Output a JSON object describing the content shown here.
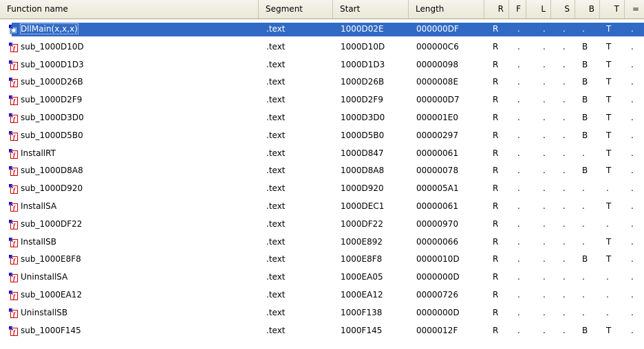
{
  "columns": [
    "Function name",
    "Segment",
    "Start",
    "Length",
    "R",
    "F",
    "L",
    "S",
    "B",
    "T",
    "="
  ],
  "rows": [
    {
      "name": "DllMain(x,x,x)",
      "segment": ".text",
      "start": "1000D02E",
      "length": "000000DF",
      "R": "R",
      "F": ".",
      "L": ".",
      "S": ".",
      "B": ".",
      "T": "T",
      "E": ".",
      "icon": "library-function-icon",
      "selected": true
    },
    {
      "name": "sub_1000D10D",
      "segment": ".text",
      "start": "1000D10D",
      "length": "000000C6",
      "R": "R",
      "F": ".",
      "L": ".",
      "S": ".",
      "B": "B",
      "T": "T",
      "E": ".",
      "icon": "function-icon"
    },
    {
      "name": "sub_1000D1D3",
      "segment": ".text",
      "start": "1000D1D3",
      "length": "00000098",
      "R": "R",
      "F": ".",
      "L": ".",
      "S": ".",
      "B": "B",
      "T": "T",
      "E": ".",
      "icon": "function-icon"
    },
    {
      "name": "sub_1000D26B",
      "segment": ".text",
      "start": "1000D26B",
      "length": "0000008E",
      "R": "R",
      "F": ".",
      "L": ".",
      "S": ".",
      "B": "B",
      "T": "T",
      "E": ".",
      "icon": "function-icon"
    },
    {
      "name": "sub_1000D2F9",
      "segment": ".text",
      "start": "1000D2F9",
      "length": "000000D7",
      "R": "R",
      "F": ".",
      "L": ".",
      "S": ".",
      "B": "B",
      "T": "T",
      "E": ".",
      "icon": "function-icon"
    },
    {
      "name": "sub_1000D3D0",
      "segment": ".text",
      "start": "1000D3D0",
      "length": "000001E0",
      "R": "R",
      "F": ".",
      "L": ".",
      "S": ".",
      "B": "B",
      "T": "T",
      "E": ".",
      "icon": "function-icon"
    },
    {
      "name": "sub_1000D5B0",
      "segment": ".text",
      "start": "1000D5B0",
      "length": "00000297",
      "R": "R",
      "F": ".",
      "L": ".",
      "S": ".",
      "B": "B",
      "T": "T",
      "E": ".",
      "icon": "function-icon"
    },
    {
      "name": "InstallRT",
      "segment": ".text",
      "start": "1000D847",
      "length": "00000061",
      "R": "R",
      "F": ".",
      "L": ".",
      "S": ".",
      "B": ".",
      "T": "T",
      "E": ".",
      "icon": "function-icon"
    },
    {
      "name": "sub_1000D8A8",
      "segment": ".text",
      "start": "1000D8A8",
      "length": "00000078",
      "R": "R",
      "F": ".",
      "L": ".",
      "S": ".",
      "B": "B",
      "T": "T",
      "E": ".",
      "icon": "function-icon"
    },
    {
      "name": "sub_1000D920",
      "segment": ".text",
      "start": "1000D920",
      "length": "000005A1",
      "R": "R",
      "F": ".",
      "L": ".",
      "S": ".",
      "B": ".",
      "T": ".",
      "E": ".",
      "icon": "function-icon"
    },
    {
      "name": "InstallSA",
      "segment": ".text",
      "start": "1000DEC1",
      "length": "00000061",
      "R": "R",
      "F": ".",
      "L": ".",
      "S": ".",
      "B": ".",
      "T": "T",
      "E": ".",
      "icon": "function-icon"
    },
    {
      "name": "sub_1000DF22",
      "segment": ".text",
      "start": "1000DF22",
      "length": "00000970",
      "R": "R",
      "F": ".",
      "L": ".",
      "S": ".",
      "B": ".",
      "T": ".",
      "E": ".",
      "icon": "function-icon"
    },
    {
      "name": "InstallSB",
      "segment": ".text",
      "start": "1000E892",
      "length": "00000066",
      "R": "R",
      "F": ".",
      "L": ".",
      "S": ".",
      "B": ".",
      "T": "T",
      "E": ".",
      "icon": "function-icon"
    },
    {
      "name": "sub_1000E8F8",
      "segment": ".text",
      "start": "1000E8F8",
      "length": "0000010D",
      "R": "R",
      "F": ".",
      "L": ".",
      "S": ".",
      "B": "B",
      "T": "T",
      "E": ".",
      "icon": "function-icon"
    },
    {
      "name": "UninstallSA",
      "segment": ".text",
      "start": "1000EA05",
      "length": "0000000D",
      "R": "R",
      "F": ".",
      "L": ".",
      "S": ".",
      "B": ".",
      "T": ".",
      "E": ".",
      "icon": "function-icon"
    },
    {
      "name": "sub_1000EA12",
      "segment": ".text",
      "start": "1000EA12",
      "length": "00000726",
      "R": "R",
      "F": ".",
      "L": ".",
      "S": ".",
      "B": ".",
      "T": ".",
      "E": ".",
      "icon": "function-icon"
    },
    {
      "name": "UninstallSB",
      "segment": ".text",
      "start": "1000F138",
      "length": "0000000D",
      "R": "R",
      "F": ".",
      "L": ".",
      "S": ".",
      "B": ".",
      "T": ".",
      "E": ".",
      "icon": "function-icon"
    },
    {
      "name": "sub_1000F145",
      "segment": ".text",
      "start": "1000F145",
      "length": "0000012F",
      "R": "R",
      "F": ".",
      "L": ".",
      "S": ".",
      "B": "B",
      "T": "T",
      "E": ".",
      "icon": "function-icon"
    }
  ],
  "colors": {
    "selection": "#316ac5",
    "header_bg": "#ece9d8",
    "icon_red": "#cc0000",
    "arrow_blue": "#0000cc"
  }
}
